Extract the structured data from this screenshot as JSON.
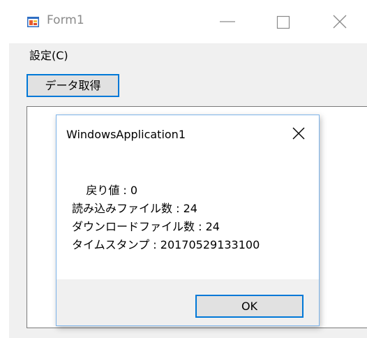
{
  "window": {
    "title": "Form1",
    "icon": "form-app-icon",
    "controls": [
      "minimize-icon",
      "maximize-icon",
      "close-icon"
    ]
  },
  "menu": {
    "settings_label": "設定(C)"
  },
  "main": {
    "fetch_button_label": "データ取得"
  },
  "dialog": {
    "title": "WindowsApplication1",
    "message_lines": [
      "    戻り値 : 0",
      "読み込みファイル数 : 24",
      "ダウンロードファイル数 : 24",
      "タイムスタンプ : 20170529133100"
    ],
    "ok_label": "OK"
  },
  "colors": {
    "focus_border": "#0078d7",
    "dialog_border": "#7eb4ea",
    "button_face": "#e1e1e1",
    "form_background": "#f0f0f0"
  }
}
